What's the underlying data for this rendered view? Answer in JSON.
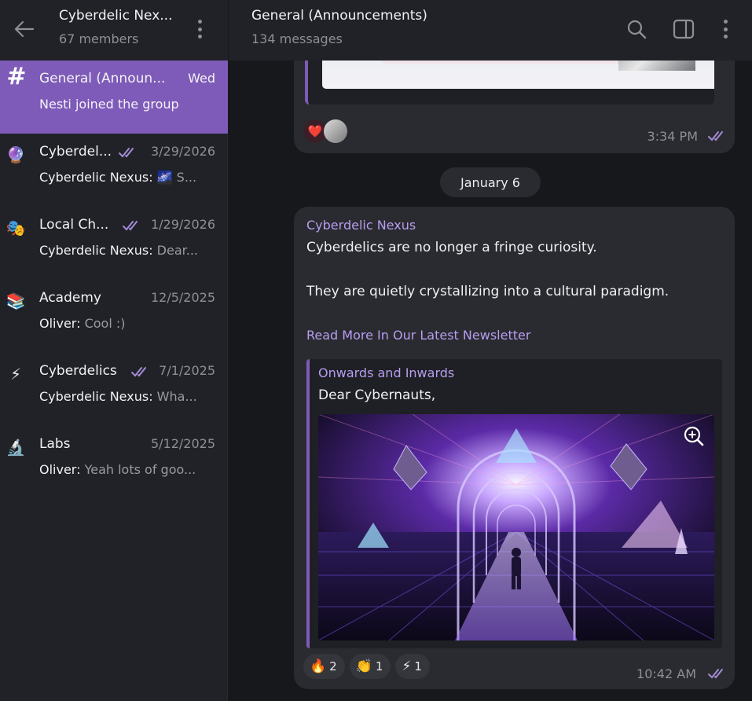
{
  "sidebar": {
    "title": "Cyberdelic Nex...",
    "members": "67 members",
    "chats": [
      {
        "name": "General (Announ...",
        "date": "Wed",
        "sender": "",
        "preview": "Nesti joined the group",
        "icon": "#",
        "active": true,
        "read": false
      },
      {
        "name": "Cyberdel...",
        "date": "3/29/2026",
        "sender": "Cyberdelic Nexus: ",
        "preview": "🌌 S...",
        "icon": "🔮",
        "active": false,
        "read": true
      },
      {
        "name": "Local Ch...",
        "date": "1/29/2026",
        "sender": "Cyberdelic Nexus: ",
        "preview": "Dear...",
        "icon": "🎭",
        "active": false,
        "read": true
      },
      {
        "name": "Academy",
        "date": "12/5/2025",
        "sender": "Oliver: ",
        "preview": "Cool :)",
        "icon": "📚",
        "active": false,
        "read": false
      },
      {
        "name": "Cyberdelics",
        "date": "7/1/2025",
        "sender": "Cyberdelic Nexus: ",
        "preview": "Wha...",
        "icon": "⚡",
        "active": false,
        "read": true
      },
      {
        "name": "Labs",
        "date": "5/12/2025",
        "sender": "Oliver: ",
        "preview": "Yeah lots of goo...",
        "icon": "🔬",
        "active": false,
        "read": false
      }
    ]
  },
  "header": {
    "title": "General (Announcements)",
    "subtitle": "134 messages"
  },
  "messages": {
    "prev_time": "3:34 PM",
    "date_separator": "January 6",
    "sender": "Cyberdelic Nexus",
    "line1": "Cyberdelics are no longer a fringe curiosity.",
    "line2": "They are quietly crystallizing into a cultural paradigm.",
    "link_text": "Read More In Our Latest Newsletter",
    "card_title": "Onwards and Inwards",
    "card_desc": "Dear Cybernauts,",
    "reactions": [
      {
        "emoji": "🔥",
        "count": "2"
      },
      {
        "emoji": "👏",
        "count": "1"
      },
      {
        "emoji": "⚡",
        "count": "1"
      }
    ],
    "time": "10:42 AM"
  },
  "colors": {
    "accent": "#7e5bb8",
    "link": "#b79df0",
    "sidebar_bg": "#212227",
    "chat_bg": "#17181c",
    "bubble_bg": "#2a2b30"
  }
}
